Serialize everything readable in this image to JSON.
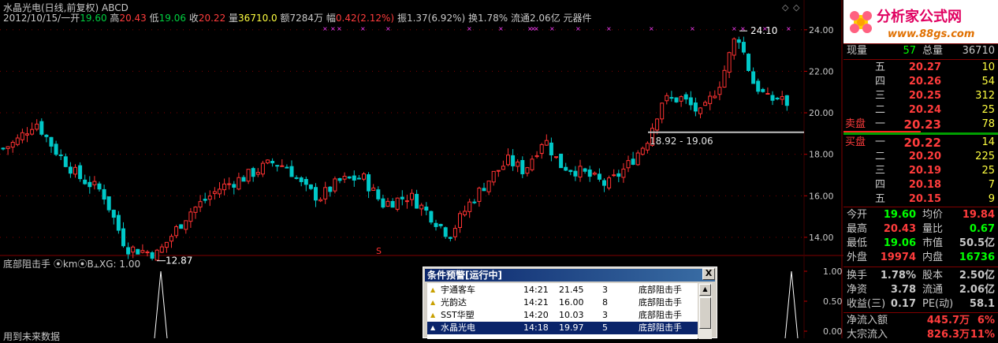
{
  "header": {
    "title": "水晶光电(日线,前复权) ABCD",
    "date": "2012/10/15/一",
    "open_label": "开",
    "open": "19.60",
    "high_label": "高",
    "high": "20.43",
    "low_label": "低",
    "low": "19.06",
    "close_label": "收",
    "close": "20.22",
    "vol_label": "量",
    "vol": "36710.0",
    "amt_label": "额",
    "amt": "7284万",
    "chg_label": "幅",
    "chg": "0.42(2.12%)",
    "amp_label": "振",
    "amp": "1.37(6.92%)",
    "turn_label": "换",
    "turn": "1.78%",
    "float_label": "流通",
    "float": "2.06亿",
    "sector": "元器件"
  },
  "chart_data": {
    "type": "candlestick",
    "ylim": [
      13.2,
      24.6
    ],
    "yticks": [
      "24.00",
      "22.00",
      "20.00",
      "18.00",
      "16.00",
      "14.00"
    ],
    "annotations": {
      "high_mark": "24.10",
      "low_mark": "12.87",
      "range_label": "18.92 - 19.06"
    },
    "colors": {
      "up": "#ff3232",
      "down": "#00c8c8",
      "grid": "#800000",
      "marker": "#ff40ff"
    }
  },
  "indicator": {
    "name": "底部阻击手",
    "opt1": "km",
    "opt2": "B",
    "opt2_suffix": "XG: 1.00",
    "yticks": [
      "1.00",
      "0.50",
      "0.00"
    ],
    "footer_text": "用到未来数据"
  },
  "logo": {
    "title": "分析家公式网",
    "url": "www.88gs.com"
  },
  "quote": {
    "now_label": "现量",
    "now": "57",
    "total_label": "总量",
    "total": "36710",
    "sell": [
      {
        "label": "五",
        "price": "20.27",
        "vol": "10"
      },
      {
        "label": "四",
        "price": "20.26",
        "vol": "54"
      },
      {
        "label": "三",
        "price": "20.25",
        "vol": "312"
      },
      {
        "label": "二",
        "price": "20.24",
        "vos": "",
        "vol": "25"
      },
      {
        "label": "一",
        "price": "20.23",
        "vol": "78"
      }
    ],
    "sell_label": "卖盘",
    "buy_label": "买盘",
    "buy": [
      {
        "label": "一",
        "price": "20.22",
        "vol": "14"
      },
      {
        "label": "二",
        "price": "20.20",
        "vol": "225"
      },
      {
        "label": "三",
        "price": "20.19",
        "vol": "25"
      },
      {
        "label": "四",
        "price": "20.18",
        "vol": "7"
      },
      {
        "label": "五",
        "price": "20.15",
        "vol": "9"
      }
    ],
    "stats": [
      {
        "l1": "今开",
        "v1": "19.60",
        "l2": "均价",
        "v2": "19.84",
        "c1": "#00ff00",
        "c2": "#ff3c3c"
      },
      {
        "l1": "最高",
        "v1": "20.43",
        "l2": "量比",
        "v2": "0.67",
        "c1": "#ff3c3c",
        "c2": "#00ff00"
      },
      {
        "l1": "最低",
        "v1": "19.06",
        "l2": "市值",
        "v2": "50.5亿",
        "c1": "#00ff00",
        "c2": "#c8c8c8"
      },
      {
        "l1": "外盘",
        "v1": "19974",
        "l2": "内盘",
        "v2": "16736",
        "c1": "#ff3c3c",
        "c2": "#00ff00"
      }
    ],
    "stats2": [
      {
        "l1": "换手",
        "v1": "1.78%",
        "l2": "股本",
        "v2": "2.50亿"
      },
      {
        "l1": "净资",
        "v1": "3.78",
        "l2": "流通",
        "v2": "2.06亿"
      },
      {
        "l1": "收益(三)",
        "v1": "0.17",
        "l2": "PE(动)",
        "v2": "58.1"
      }
    ],
    "flow1_label": "净流入额",
    "flow1": "445.7万",
    "flow1_pct": "6%",
    "flow2_label": "大宗流入",
    "flow2": "826.3万",
    "flow2_pct": "11%"
  },
  "popup": {
    "title": "条件预警[运行中]",
    "close": "X",
    "rows": [
      {
        "name": "宇通客车",
        "time": "14:21",
        "price": "21.45",
        "n": "3",
        "formula": "底部阻击手"
      },
      {
        "name": "光韵达",
        "time": "14:21",
        "price": "16.00",
        "n": "8",
        "formula": "底部阻击手"
      },
      {
        "name": "SST华塑",
        "time": "14:20",
        "price": "10.03",
        "n": "3",
        "formula": "底部阻击手"
      },
      {
        "name": "水晶光电",
        "time": "14:18",
        "price": "19.97",
        "n": "5",
        "formula": "底部阻击手"
      }
    ]
  }
}
